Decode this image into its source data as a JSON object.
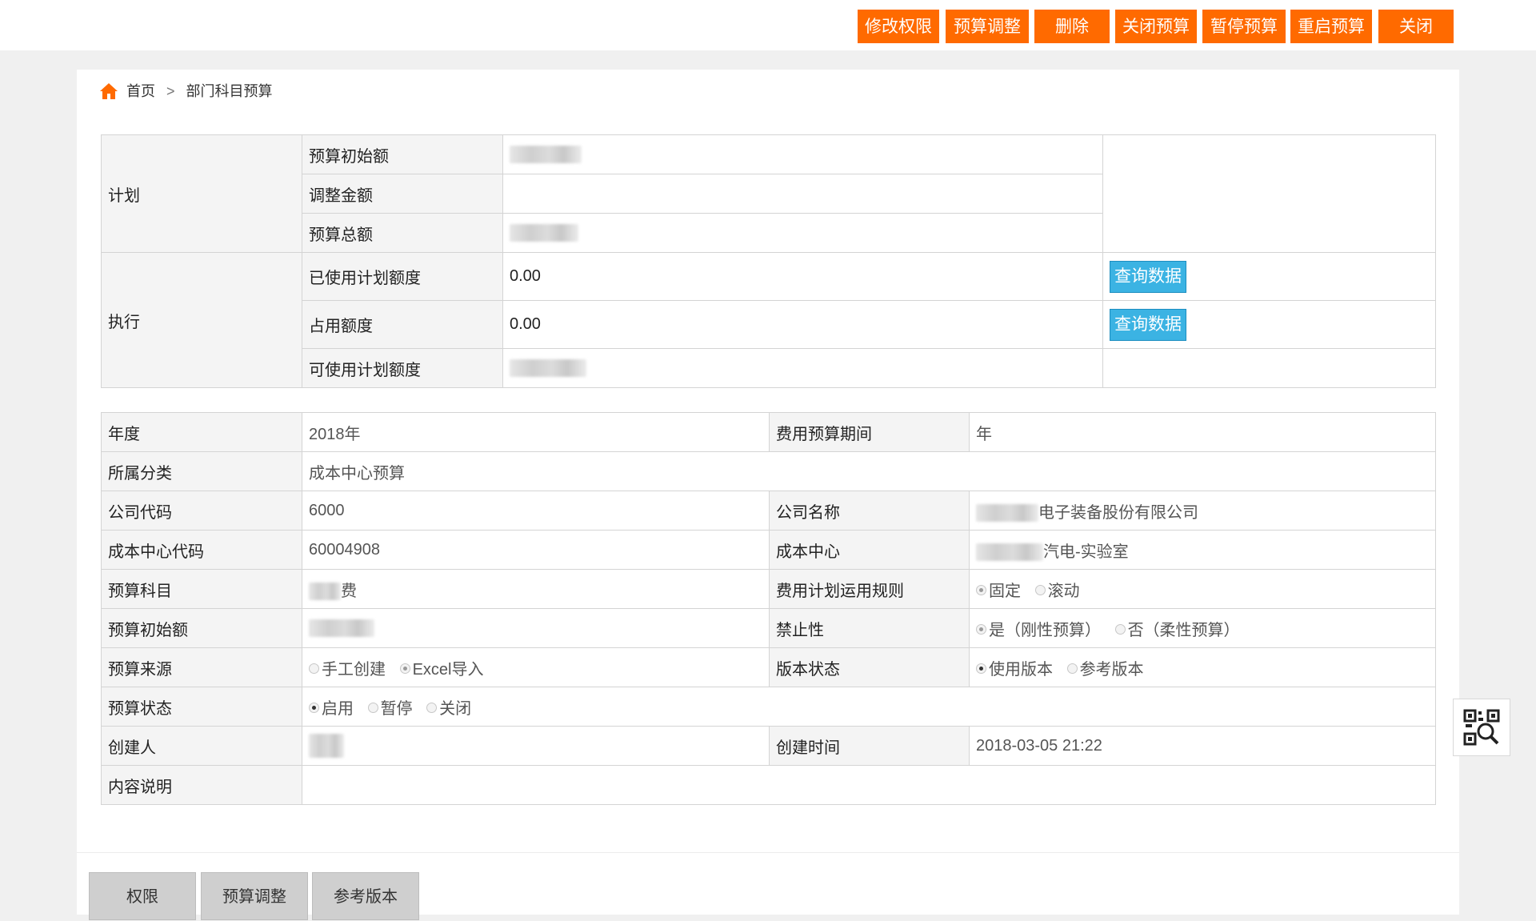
{
  "toolbar": {
    "buttons": [
      "修改权限",
      "预算调整",
      "删除",
      "关闭预算",
      "暂停预算",
      "重启预算",
      "关闭"
    ]
  },
  "breadcrumb": {
    "home": "首页",
    "sep": ">",
    "current": "部门科目预算"
  },
  "plan_table": {
    "plan_label": "计划",
    "exec_label": "执行",
    "rows": {
      "initial_amount": "预算初始额",
      "adjust_amount": "调整金额",
      "total_amount": "预算总额",
      "used_quota": "已使用计划额度",
      "used_quota_value": "0.00",
      "occupied_quota": "占用额度",
      "occupied_quota_value": "0.00",
      "available_quota": "可使用计划额度"
    },
    "query_btn": "查询数据"
  },
  "info_table": {
    "year_label": "年度",
    "year_value": "2018年",
    "period_label": "费用预算期间",
    "period_value": "年",
    "category_label": "所属分类",
    "category_value": "成本中心预算",
    "company_code_label": "公司代码",
    "company_code_value": "6000",
    "company_name_label": "公司名称",
    "company_name_value": "电子装备股份有限公司",
    "cost_center_code_label": "成本中心代码",
    "cost_center_code_value": "60004908",
    "cost_center_label": "成本中心",
    "cost_center_value": "汽电-实验室",
    "subject_label": "预算科目",
    "subject_value": "费",
    "rule_label": "费用计划运用规则",
    "rule_opt1": "固定",
    "rule_opt2": "滚动",
    "initial_label": "预算初始额",
    "prohibit_label": "禁止性",
    "prohibit_opt1": "是（刚性预算）",
    "prohibit_opt2": "否（柔性预算）",
    "source_label": "预算来源",
    "source_opt1": "手工创建",
    "source_opt2": "Excel导入",
    "version_label": "版本状态",
    "version_opt1": "使用版本",
    "version_opt2": "参考版本",
    "status_label": "预算状态",
    "status_opt1": "启用",
    "status_opt2": "暂停",
    "status_opt3": "关闭",
    "creator_label": "创建人",
    "created_time_label": "创建时间",
    "created_time_value": "2018-03-05 21:22",
    "desc_label": "内容说明"
  },
  "bottom_tabs": [
    "权限",
    "预算调整",
    "参考版本"
  ],
  "colors": {
    "accent": "#ff6a00",
    "query": "#3bb3e3"
  },
  "icons": {
    "home": "home-icon",
    "qr": "qr-scan-icon"
  }
}
